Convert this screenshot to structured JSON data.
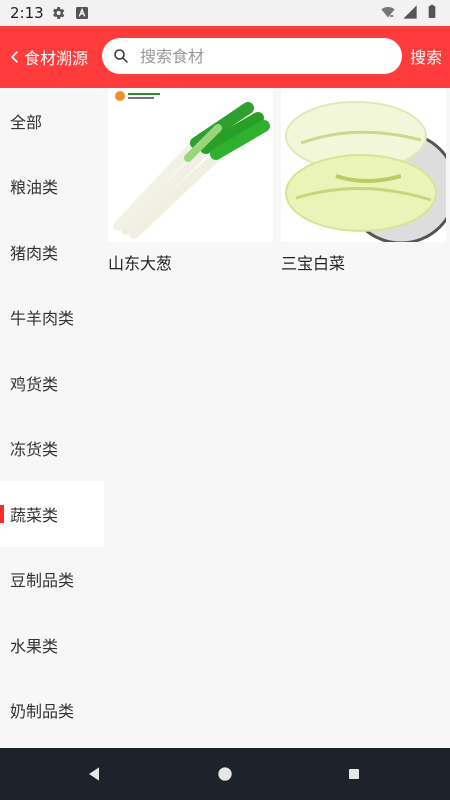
{
  "status": {
    "time": "2:13",
    "icons_left": [
      "gear-icon",
      "app-a-icon"
    ],
    "icons_right": [
      "wifi-icon",
      "signal-icon",
      "battery-icon"
    ]
  },
  "header": {
    "back_label": "食材溯源",
    "search_placeholder": "搜索食材",
    "search_value": "",
    "search_action": "搜索",
    "accent_color": "#ff3b3b"
  },
  "sidebar": {
    "items": [
      {
        "label": "全部",
        "active": false
      },
      {
        "label": "粮油类",
        "active": false
      },
      {
        "label": "猪肉类",
        "active": false
      },
      {
        "label": "牛羊肉类",
        "active": false
      },
      {
        "label": "鸡货类",
        "active": false
      },
      {
        "label": "冻货类",
        "active": false
      },
      {
        "label": "蔬菜类",
        "active": true
      },
      {
        "label": "豆制品类",
        "active": false
      },
      {
        "label": "水果类",
        "active": false
      },
      {
        "label": "奶制品类",
        "active": false
      }
    ]
  },
  "products": [
    {
      "name": "山东大葱",
      "image": "scallion-image"
    },
    {
      "name": "三宝白菜",
      "image": "napa-cabbage-image"
    }
  ]
}
